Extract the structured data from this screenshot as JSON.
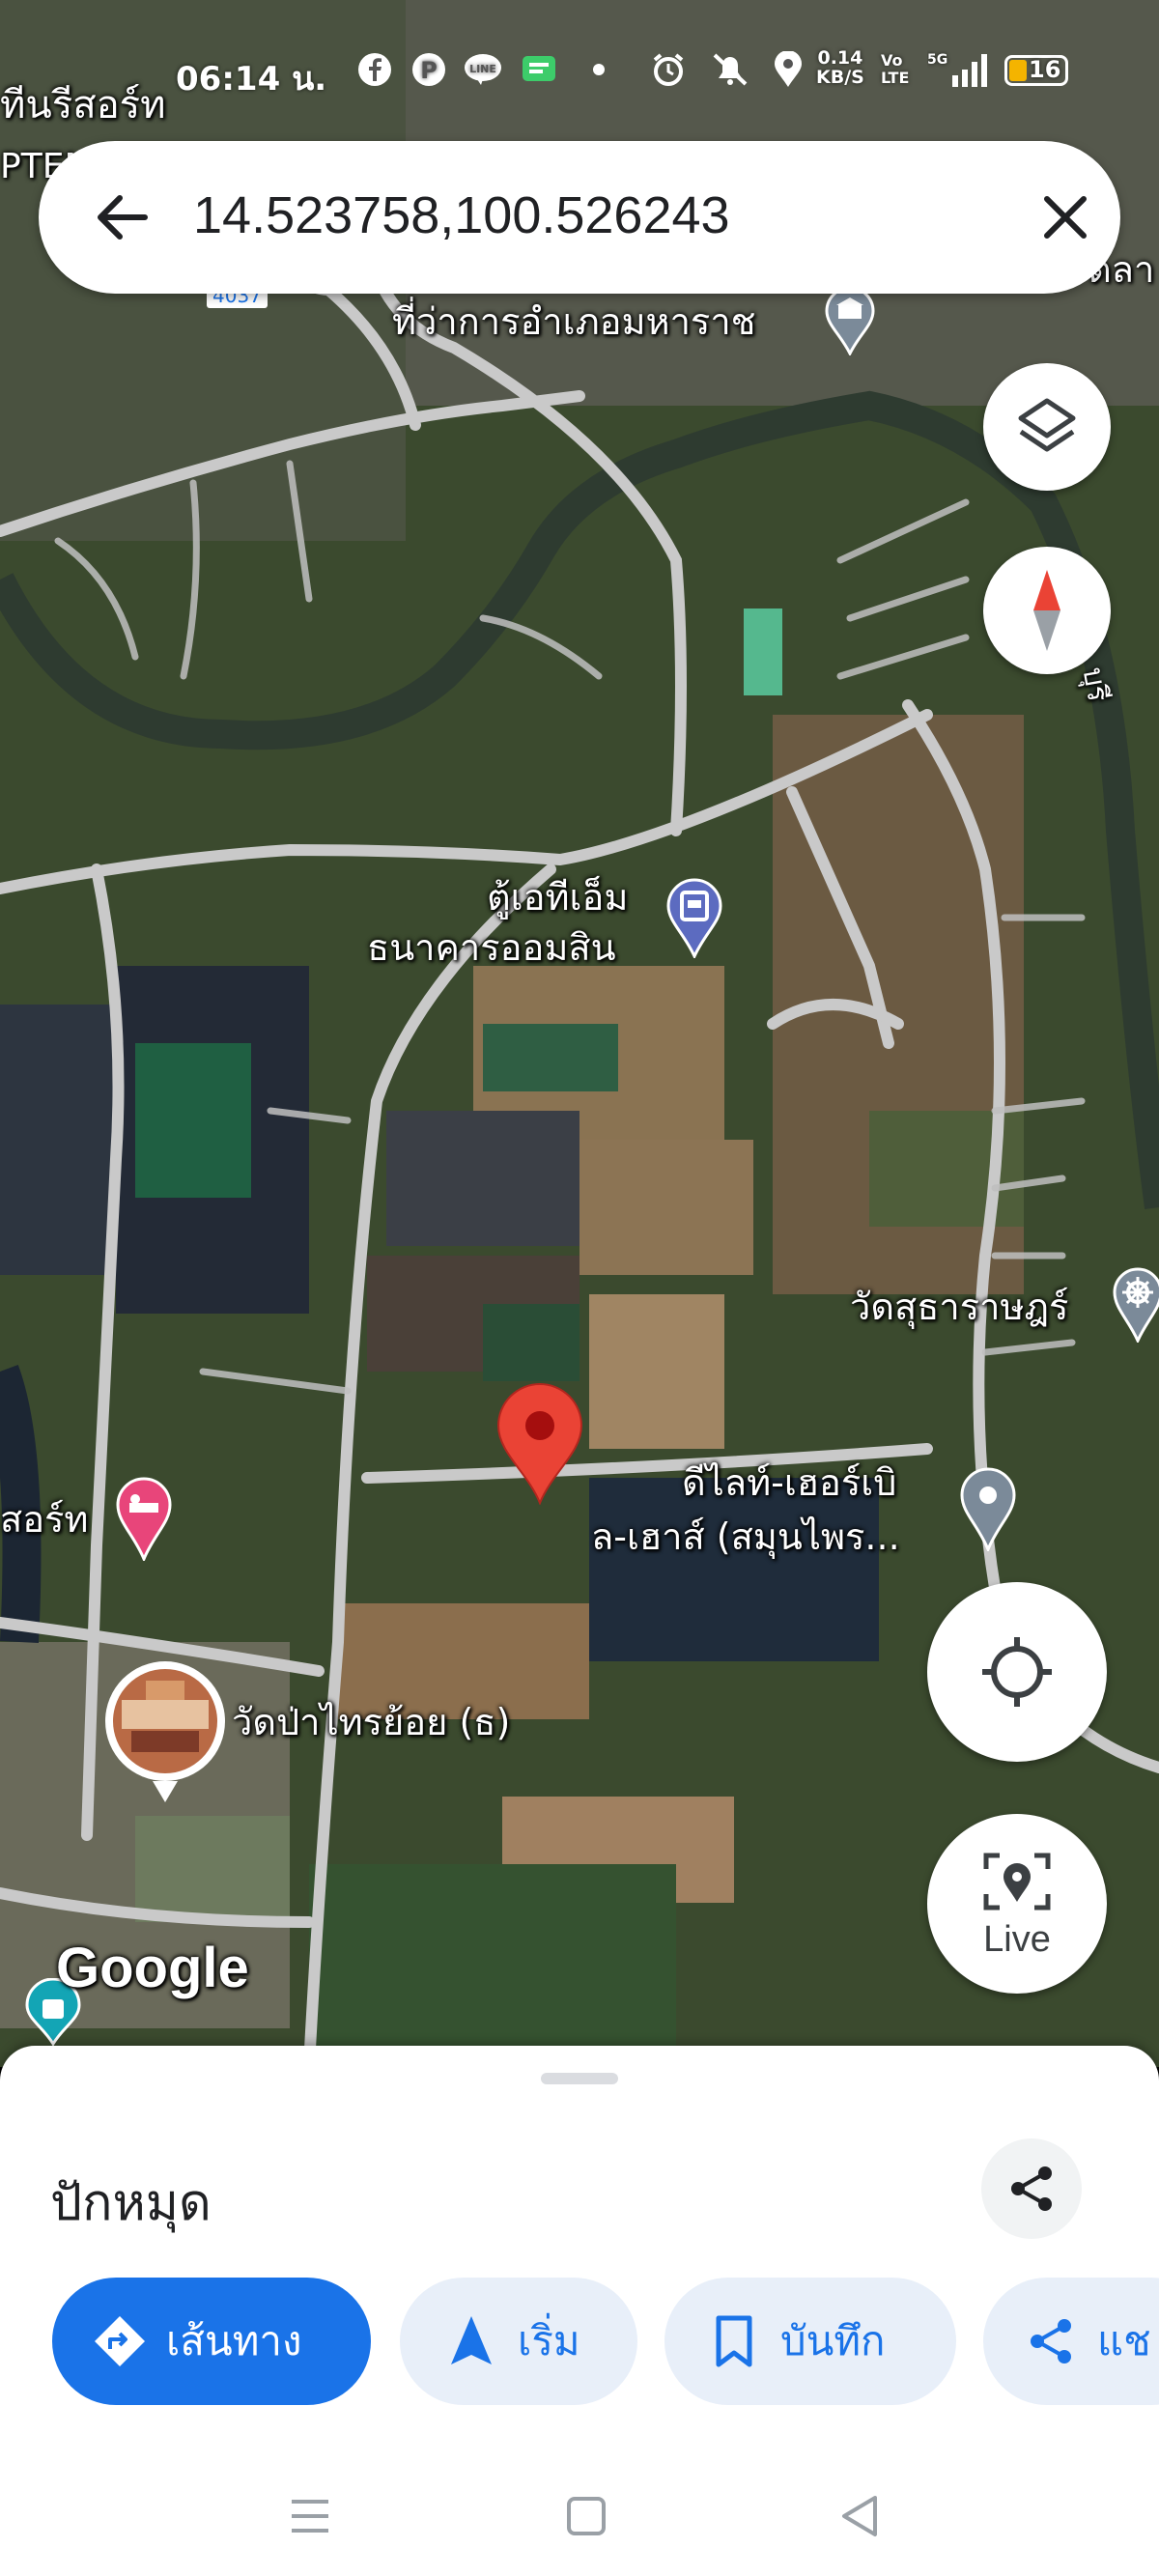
{
  "status_bar": {
    "time": "06:14 น.",
    "net_speed_value": "0.14",
    "net_speed_unit": "KB/S",
    "volte": "Vo LTE",
    "network": "5G",
    "battery": "16",
    "icons": [
      "facebook-icon",
      "pinterest-icon",
      "line-icon",
      "line-messenger-icon",
      "dot-icon",
      "alarm-icon",
      "mute-icon",
      "location-icon",
      "signal-icon",
      "battery-icon"
    ]
  },
  "search": {
    "query": "14.523758,100.526243",
    "back_icon": "arrow-back-icon",
    "clear_icon": "close-icon"
  },
  "map": {
    "labels": {
      "top_left_1": "ทีนรีสอร์ท",
      "top_left_2": "PTEM",
      "district_office": "ที่ว่าการอำเภอมหาราช",
      "top_right": "ตลา",
      "road_no": "4037",
      "roadside": "บุรี",
      "atm_1": "ตู้เอทีเอ็ม",
      "atm_2": "ธนาคารออมสิน",
      "temple_right": "วัดสุธาราษฎร์",
      "resort_left": "สอร์ท",
      "herb_1": "ดีไลท์-เฮอร์เบิ",
      "herb_2": "ล-เฮาส์ (สมุนไพร...",
      "temple_photo": "วัดป่าไทรย้อย (ธ)",
      "google": "Google"
    },
    "colors": {
      "pin": "#ea4335",
      "road": "#c9c9c9",
      "poi_blue": "#5c6bc0",
      "poi_pink": "#e8457a",
      "poi_grey": "#7b8a99",
      "poi_teal": "#13a5b5"
    }
  },
  "controls": {
    "layers_icon": "layers-icon",
    "compass_icon": "compass-icon",
    "location_icon": "my-location-icon",
    "live_label": "Live"
  },
  "sheet": {
    "title": "ปักหมุด",
    "share_icon": "share-icon",
    "chips": [
      {
        "label": "เส้นทาง",
        "icon": "directions-icon"
      },
      {
        "label": "เริ่ม",
        "icon": "navigation-arrow-icon"
      },
      {
        "label": "บันทึก",
        "icon": "bookmark-icon"
      },
      {
        "label": "แช",
        "icon": "share-icon"
      }
    ],
    "colors": {
      "primary": "#1a73e8",
      "chip_bg": "#e8eff9"
    }
  },
  "nav_bar": {
    "icons": [
      "menu-icon",
      "home-square-icon",
      "back-triangle-icon"
    ]
  }
}
